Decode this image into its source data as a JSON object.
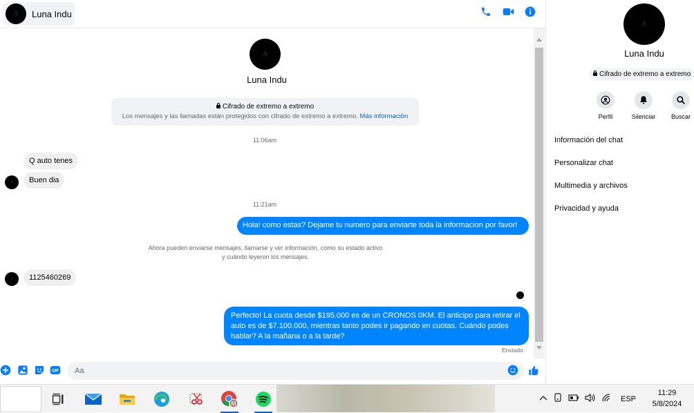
{
  "header": {
    "contact_name": "Luna Indu"
  },
  "intro": {
    "name": "Luna Indu",
    "e2e_title": "Cifrado de extremo a extremo",
    "e2e_desc": "Los mensajes y las llamadas están protegidos con cifrado de extremo a extremo.",
    "e2e_link": "Más información"
  },
  "conversation": {
    "time_1": "11:06am",
    "msg_in_1": "Q auto tenes",
    "msg_in_2": "Buen dia",
    "time_2": "11:21am",
    "msg_out_1": "Hola! como estas? Dejame tu numero para enviarte toda la informacion por favor!",
    "system_note": "Ahora pueden enviarse mensajes, llamarse y ver información, como su estado activo y cuándo leyeron los mensajes.",
    "msg_in_3": "1125460269",
    "msg_out_2": "Perfecto! La cuota desde $195.000 es de un CRONOS 0KM. El anticipo para retirar el auto es de $7.100.000, mientras tanto podes ir pagando en cuotas. Cuándo podes hablar? A la mañana o a la tarde?",
    "status": "Enviado"
  },
  "composer": {
    "placeholder": "Aa"
  },
  "panel": {
    "name": "Luna Indu",
    "e2e": "Cifrado de extremo a extremo",
    "actions": [
      {
        "label": "Perfil",
        "icon": "profile-icon"
      },
      {
        "label": "Silenciar",
        "icon": "bell-icon"
      },
      {
        "label": "Buscar",
        "icon": "search-icon"
      }
    ],
    "menu": [
      "Información del chat",
      "Personalizar chat",
      "Multimedia y archivos",
      "Privacidad y ayuda"
    ]
  },
  "taskbar": {
    "apps": [
      "task-view-icon",
      "mail-icon",
      "file-explorer-icon",
      "edge-icon",
      "snipping-tool-icon",
      "chrome-icon",
      "spotify-icon"
    ],
    "language": "ESP",
    "time": "11:29",
    "date": "5/8/2024"
  },
  "colors": {
    "accent": "#0084ff",
    "icon_blue": "#0a7cff"
  }
}
